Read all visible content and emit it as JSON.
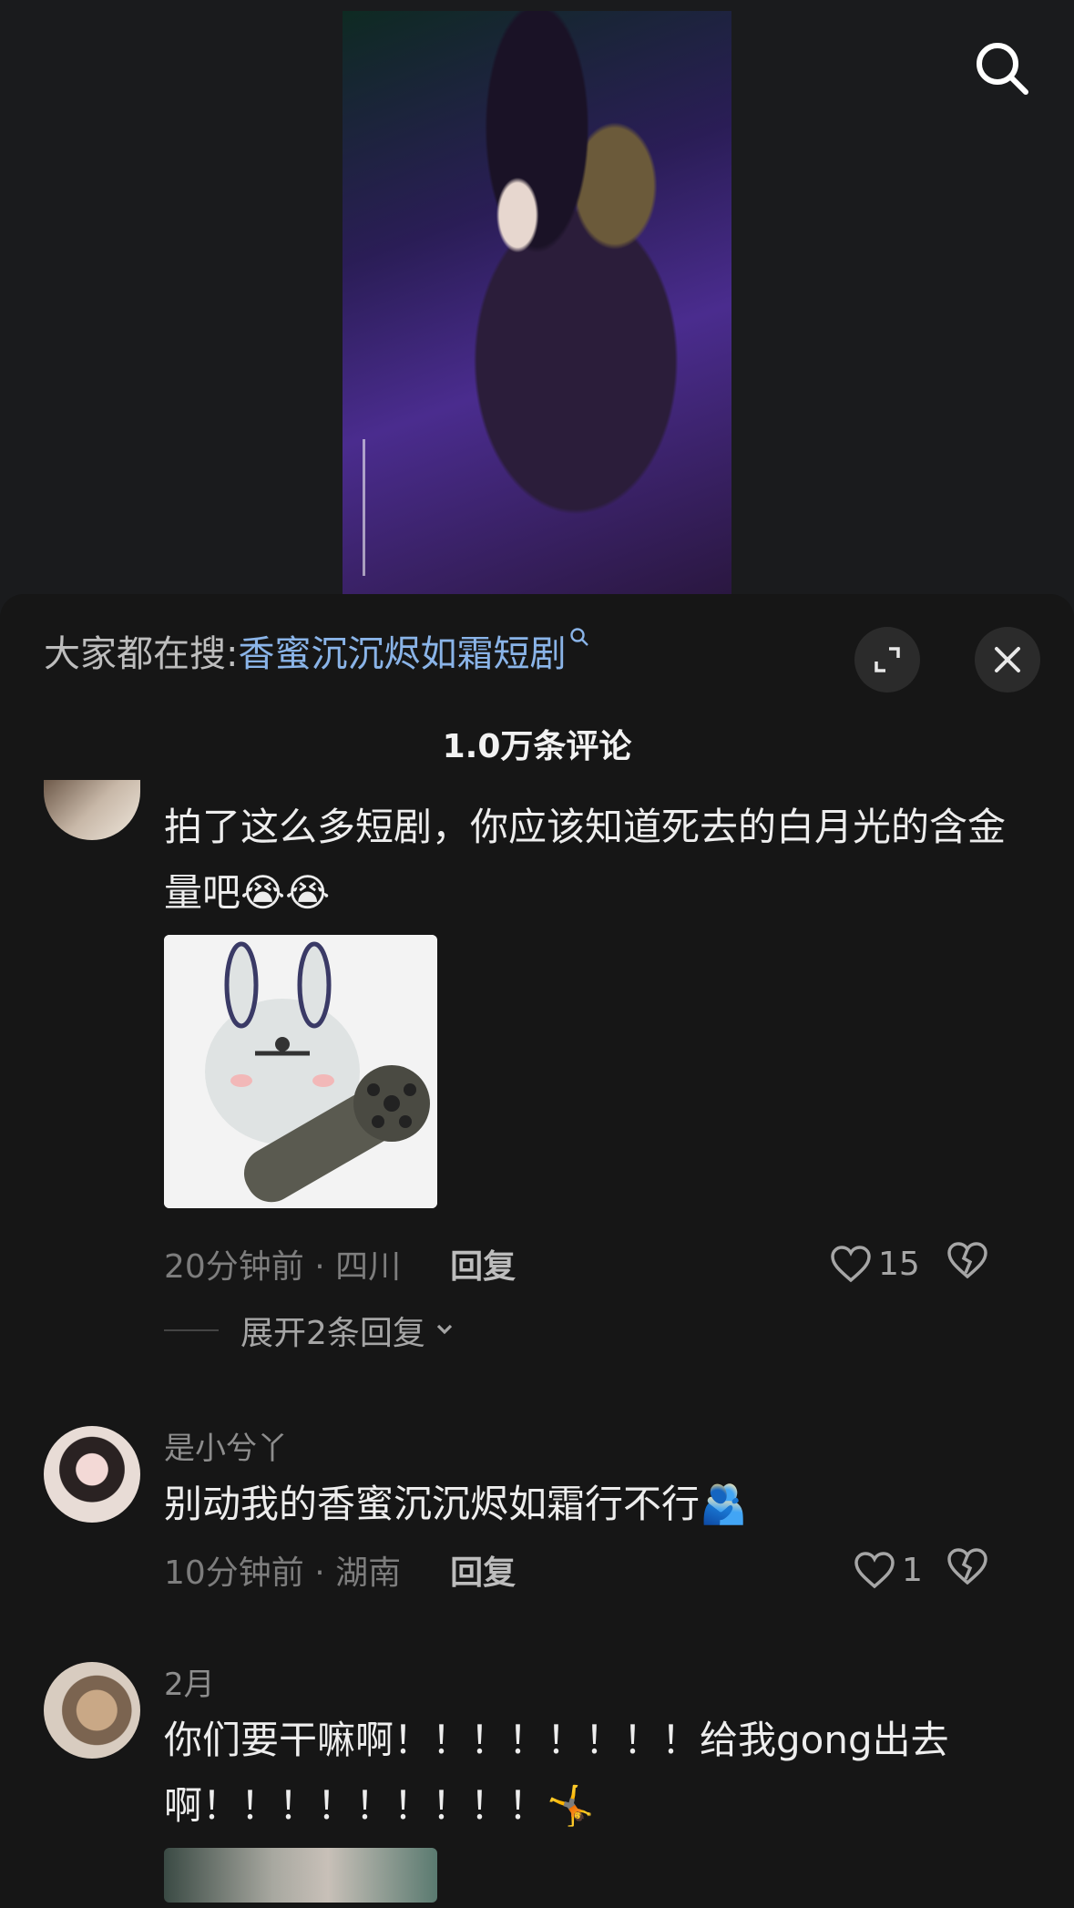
{
  "header": {
    "search_icon": "search-icon"
  },
  "search_bar": {
    "prefix": "大家都在搜:",
    "query": "香蜜沉沉烬如霜短剧",
    "query_icon": "search-small-icon"
  },
  "comment_count": "1.0万条评论",
  "comments": [
    {
      "username": "",
      "text": "拍了这么多短剧，你应该知道死去的白月光的含金量吧😭😭",
      "has_image": true,
      "time": "20分钟前 · 四川",
      "reply_label": "回复",
      "likes": "15",
      "expand_label": "展开2条回复"
    },
    {
      "username": "是小兮丫",
      "text": "别动我的香蜜沉沉烬如霜行不行🫂",
      "time": "10分钟前 · 湖南",
      "reply_label": "回复",
      "likes": "1"
    },
    {
      "username": "2月",
      "text": "你们要干嘛啊！！！！！！！！给我gong出去啊！！！！！！！！！🤸",
      "has_image": true
    }
  ],
  "colors": {
    "background": "#161616",
    "link_blue": "#8ab4e8",
    "secondary_text": "#7d7d7d"
  }
}
